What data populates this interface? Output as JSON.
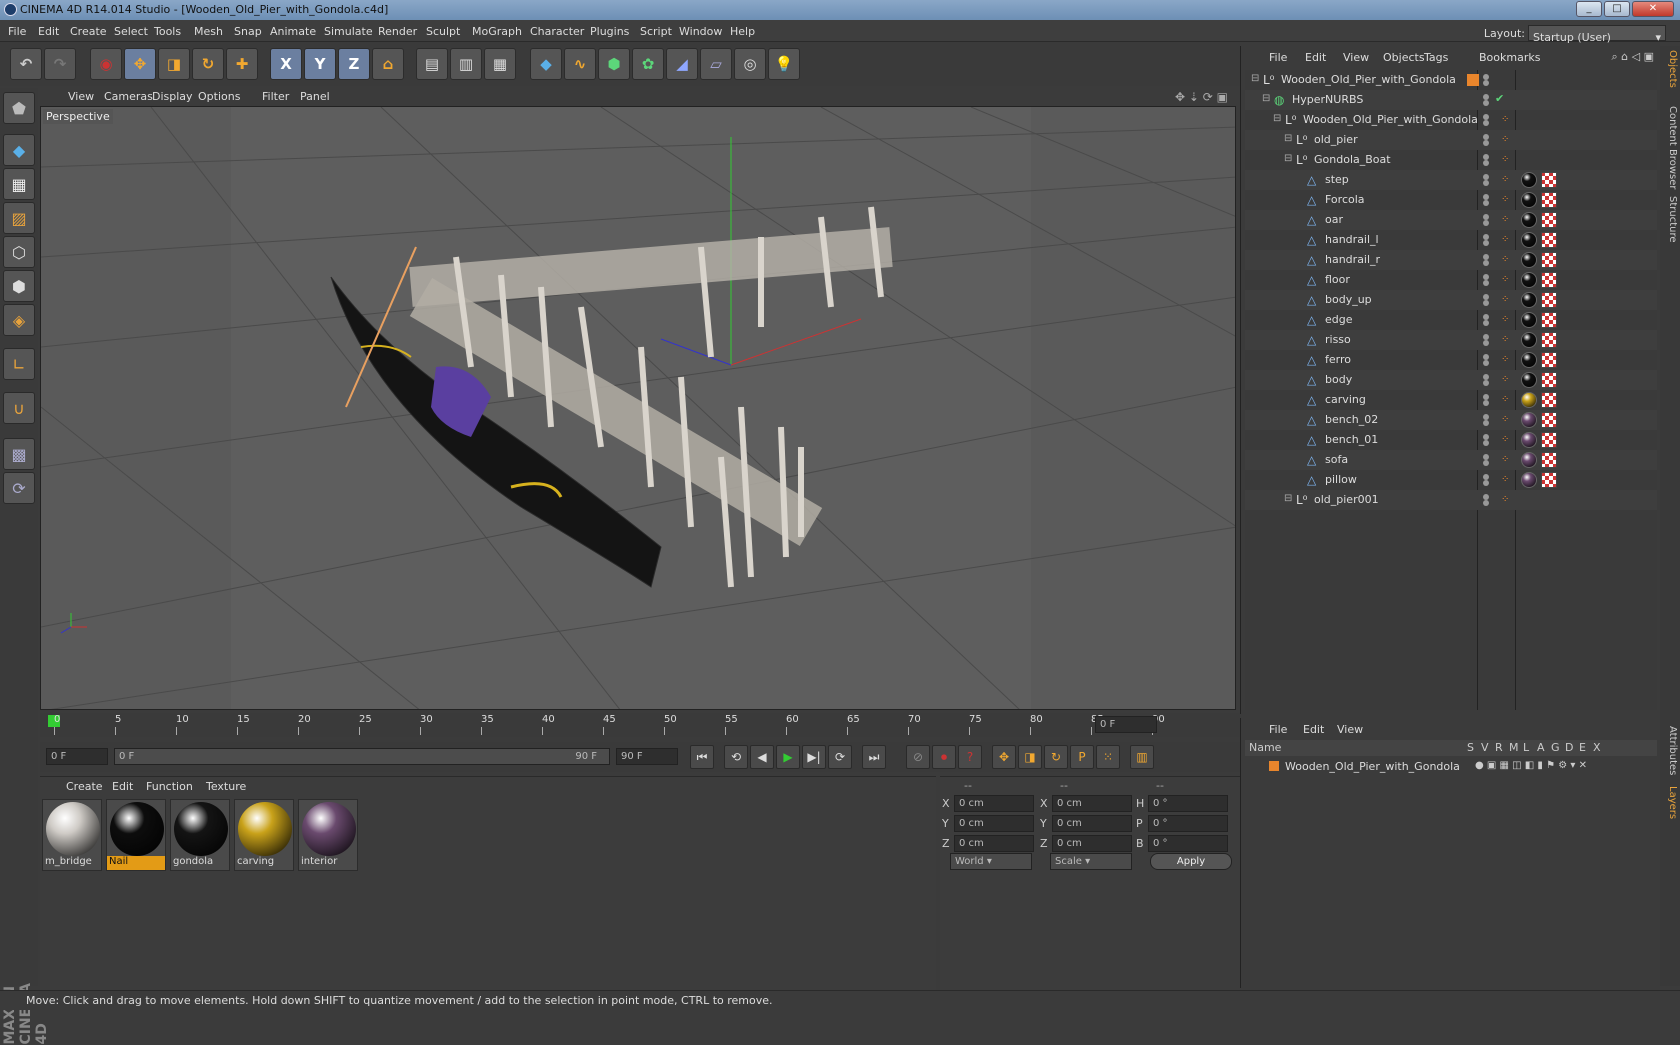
{
  "window": {
    "title": "CINEMA 4D R14.014 Studio - [Wooden_Old_Pier_with_Gondola.c4d]",
    "min": "_",
    "max": "□",
    "close": "✕"
  },
  "menu": [
    "File",
    "Edit",
    "Create",
    "Select",
    "Tools",
    "Mesh",
    "Snap",
    "Animate",
    "Simulate",
    "Render",
    "Sculpt",
    "MoGraph",
    "Character",
    "Plugins",
    "Script",
    "Window",
    "Help"
  ],
  "layout": {
    "label": "Layout:",
    "value": "Startup (User)"
  },
  "viewport": {
    "menu": [
      "View",
      "Cameras",
      "Display",
      "Options",
      "Filter",
      "Panel"
    ],
    "label": "Perspective"
  },
  "timeline": {
    "ticks": [
      "0",
      "5",
      "10",
      "15",
      "20",
      "25",
      "30",
      "35",
      "40",
      "45",
      "50",
      "55",
      "60",
      "65",
      "70",
      "75",
      "80",
      "85",
      "90"
    ],
    "frame_field": "0 F"
  },
  "controls": {
    "start": "0 F",
    "slider_left": "0 F",
    "slider_right": "90 F",
    "end": "90 F"
  },
  "materials": {
    "menu": [
      "Create",
      "Edit",
      "Function",
      "Texture"
    ],
    "items": [
      {
        "name": "m_bridge",
        "color": "#cfcbc6",
        "active": false
      },
      {
        "name": "Nail",
        "color": "#0d0d0d",
        "active": true
      },
      {
        "name": "gondola",
        "color": "#141414",
        "active": false
      },
      {
        "name": "carving",
        "color": "#c9a21a",
        "active": false
      },
      {
        "name": "interior",
        "color": "#6a4a6e",
        "active": false
      }
    ]
  },
  "coords": {
    "headers": [
      "--",
      "--",
      "--"
    ],
    "rows": [
      {
        "a": "X",
        "av": "0 cm",
        "b": "X",
        "bv": "0 cm",
        "c": "H",
        "cv": "0 °"
      },
      {
        "a": "Y",
        "av": "0 cm",
        "b": "Y",
        "bv": "0 cm",
        "c": "P",
        "cv": "0 °"
      },
      {
        "a": "Z",
        "av": "0 cm",
        "b": "Z",
        "bv": "0 cm",
        "c": "B",
        "cv": "0 °"
      }
    ],
    "world": "World",
    "scale": "Scale",
    "apply": "Apply"
  },
  "objects": {
    "menu": [
      "File",
      "Edit",
      "View",
      "Objects",
      "Tags",
      "Bookmarks"
    ],
    "tree": [
      {
        "name": "Wooden_Old_Pier_with_Gondola",
        "depth": 0,
        "type": "null",
        "tags": "layer"
      },
      {
        "name": "HyperNURBS",
        "depth": 1,
        "type": "nurbs",
        "tags": "check"
      },
      {
        "name": "Wooden_Old_Pier_with_Gondola",
        "depth": 2,
        "type": "null",
        "tags": "orn"
      },
      {
        "name": "old_pier",
        "depth": 3,
        "type": "null",
        "tags": "orn"
      },
      {
        "name": "Gondola_Boat",
        "depth": 3,
        "type": "null",
        "tags": "orn"
      },
      {
        "name": "step",
        "depth": 4,
        "type": "poly",
        "tags": "mat",
        "mat": "#111"
      },
      {
        "name": "Forcola",
        "depth": 4,
        "type": "poly",
        "tags": "mat",
        "mat": "#111"
      },
      {
        "name": "oar",
        "depth": 4,
        "type": "poly",
        "tags": "mat",
        "mat": "#111"
      },
      {
        "name": "handrail_l",
        "depth": 4,
        "type": "poly",
        "tags": "mat",
        "mat": "#111"
      },
      {
        "name": "handrail_r",
        "depth": 4,
        "type": "poly",
        "tags": "mat",
        "mat": "#111"
      },
      {
        "name": "floor",
        "depth": 4,
        "type": "poly",
        "tags": "mat",
        "mat": "#111"
      },
      {
        "name": "body_up",
        "depth": 4,
        "type": "poly",
        "tags": "mat",
        "mat": "#111"
      },
      {
        "name": "edge",
        "depth": 4,
        "type": "poly",
        "tags": "mat",
        "mat": "#111"
      },
      {
        "name": "risso",
        "depth": 4,
        "type": "poly",
        "tags": "mat",
        "mat": "#111"
      },
      {
        "name": "ferro",
        "depth": 4,
        "type": "poly",
        "tags": "mat",
        "mat": "#111"
      },
      {
        "name": "body",
        "depth": 4,
        "type": "poly",
        "tags": "mat",
        "mat": "#111"
      },
      {
        "name": "carving",
        "depth": 4,
        "type": "poly",
        "tags": "mat",
        "mat": "#c9a21a"
      },
      {
        "name": "bench_02",
        "depth": 4,
        "type": "poly",
        "tags": "mat",
        "mat": "#6a4a6e"
      },
      {
        "name": "bench_01",
        "depth": 4,
        "type": "poly",
        "tags": "mat",
        "mat": "#6a4a6e"
      },
      {
        "name": "sofa",
        "depth": 4,
        "type": "poly",
        "tags": "mat",
        "mat": "#6a4a6e"
      },
      {
        "name": "pillow",
        "depth": 4,
        "type": "poly",
        "tags": "mat",
        "mat": "#6a4a6e"
      },
      {
        "name": "old_pier001",
        "depth": 3,
        "type": "null",
        "tags": "orn"
      }
    ]
  },
  "layers": {
    "menu": [
      "File",
      "Edit",
      "View"
    ],
    "cols": [
      "Name",
      "S",
      "V",
      "R",
      "M",
      "L",
      "A",
      "G",
      "D",
      "E",
      "X"
    ],
    "row": "Wooden_Old_Pier_with_Gondola"
  },
  "sidetabs": [
    "Objects",
    "Content Browser",
    "Structure",
    "Attributes",
    "Layers"
  ],
  "brand": "MAXON CINEMA 4D",
  "status": "Move: Click and drag to move elements. Hold down SHIFT to quantize movement / add to the selection in point mode, CTRL to remove.",
  "accent": "#e8852c"
}
